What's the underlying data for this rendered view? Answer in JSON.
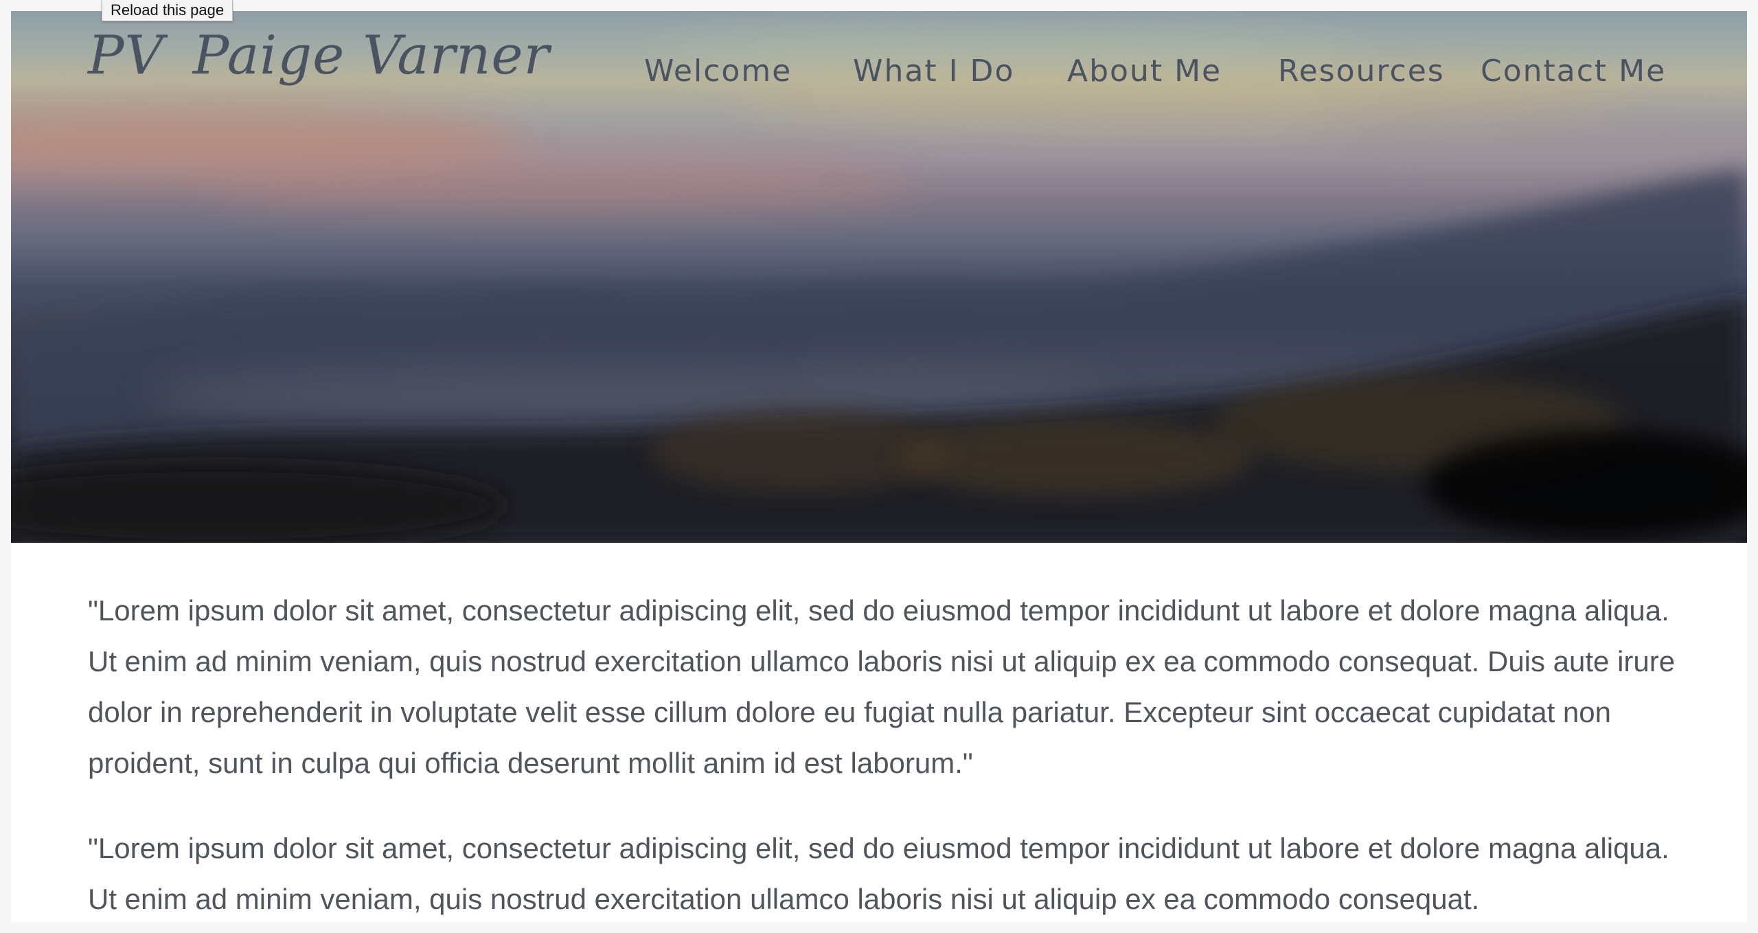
{
  "tooltip": {
    "text": "Reload this page"
  },
  "header": {
    "logo_mark": "PV",
    "logo_name": "Paige Varner",
    "nav": [
      {
        "label": "Welcome"
      },
      {
        "label": "What I Do"
      },
      {
        "label": "About Me"
      },
      {
        "label": "Resources"
      },
      {
        "label": "Contact Me"
      }
    ]
  },
  "content": {
    "paragraphs": [
      "\"Lorem ipsum dolor sit amet, consectetur adipiscing elit, sed do eiusmod tempor incididunt ut labore et dolore magna aliqua. Ut enim ad minim veniam, quis nostrud exercitation ullamco laboris nisi ut aliquip ex ea commodo consequat. Duis aute irure dolor in reprehenderit in voluptate velit esse cillum dolore eu fugiat nulla pariatur. Excepteur sint occaecat cupidatat non proident, sunt in culpa qui officia deserunt mollit anim id est laborum.\"",
      "\"Lorem ipsum dolor sit amet, consectetur adipiscing elit, sed do eiusmod tempor incididunt ut labore et dolore magna aliqua. Ut enim ad minim veniam, quis nostrud exercitation ullamco laboris nisi ut aliquip ex ea commodo consequat."
    ]
  },
  "colors": {
    "page_background": "#f7f7f8",
    "text": "#50545c",
    "nav_text": "#4a5361",
    "sky_top": "#8f9ea8",
    "sky_glow": "#b59a8e",
    "mountains": "#2a3040"
  },
  "icons": {
    "hero": "blurred-sunset-landscape"
  }
}
